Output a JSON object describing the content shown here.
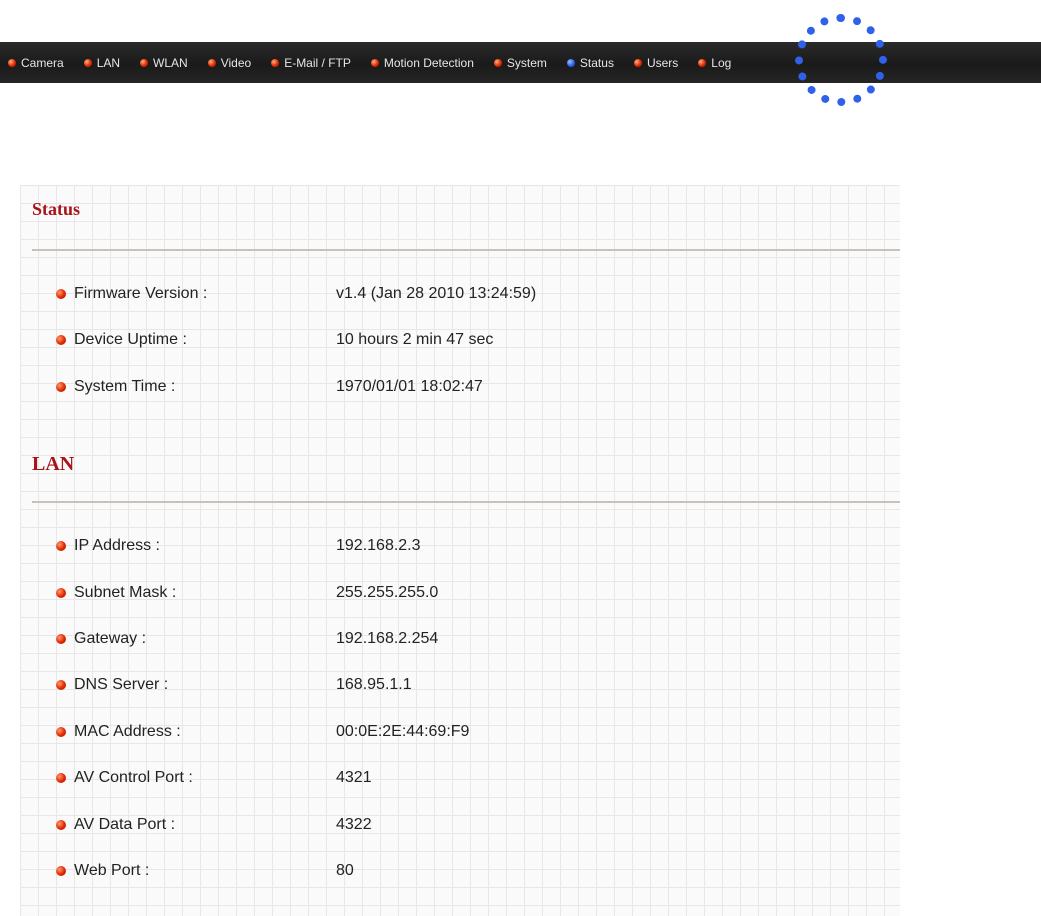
{
  "nav": {
    "items": [
      {
        "label": "Camera"
      },
      {
        "label": "LAN"
      },
      {
        "label": "WLAN"
      },
      {
        "label": "Video"
      },
      {
        "label": "E-Mail / FTP"
      },
      {
        "label": "Motion Detection"
      },
      {
        "label": "System"
      },
      {
        "label": "Status",
        "active": true
      },
      {
        "label": "Users"
      },
      {
        "label": "Log"
      }
    ],
    "highlight_color": "#2f62e8"
  },
  "status": {
    "title": "Status",
    "rows": [
      {
        "label": "Firmware Version :",
        "value": "v1.4 (Jan 28 2010 13:24:59)"
      },
      {
        "label": "Device Uptime :",
        "value": "10 hours 2 min 47 sec"
      },
      {
        "label": "System Time :",
        "value": "1970/01/01 18:02:47"
      }
    ]
  },
  "lan": {
    "title": "LAN",
    "rows": [
      {
        "label": "IP Address :",
        "value": "192.168.2.3"
      },
      {
        "label": "Subnet Mask :",
        "value": "255.255.255.0"
      },
      {
        "label": "Gateway :",
        "value": "192.168.2.254"
      },
      {
        "label": "DNS Server :",
        "value": "168.95.1.1"
      },
      {
        "label": "MAC Address :",
        "value": "00:0E:2E:44:69:F9"
      },
      {
        "label": "AV Control Port :",
        "value": "4321"
      },
      {
        "label": "AV Data Port :",
        "value": "4322"
      },
      {
        "label": "Web Port :",
        "value": "80"
      }
    ]
  },
  "colors": {
    "title_red": "#a8131a",
    "bullet_red": "#e02800",
    "nav_bg": "#1a1a1a"
  }
}
